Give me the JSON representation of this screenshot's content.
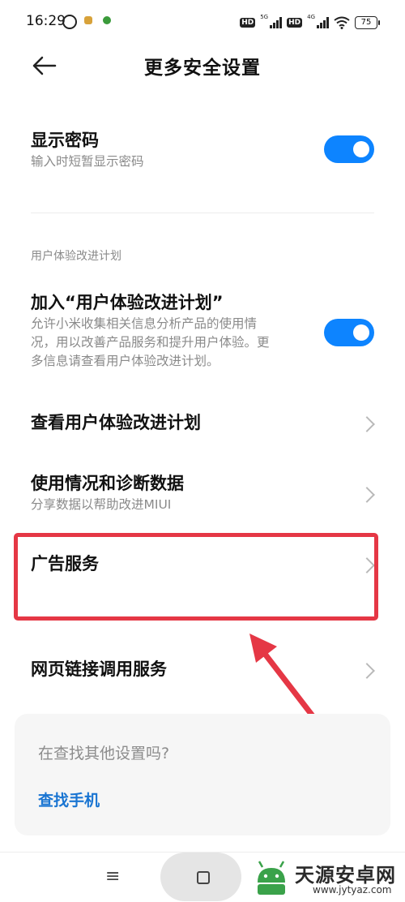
{
  "status_bar": {
    "time": "16:29",
    "hd_label": "HD",
    "net1": "5G",
    "net2": "4G",
    "battery": "75"
  },
  "header": {
    "title": "更多安全设置",
    "back_icon": "back-arrow-icon"
  },
  "settings": {
    "show_password": {
      "title": "显示密码",
      "subtitle": "输入时短暂显示密码",
      "enabled": true
    },
    "section_label": "用户体验改进计划",
    "join_plan": {
      "title": "加入“用户体验改进计划”",
      "subtitle_line1": "允许小米收集相关信息分析产品的使用情",
      "subtitle_line2": "况，用以改善产品服务和提升用户体验。更",
      "subtitle_line3": "多信息请查看用户体验改进计划。",
      "enabled": true
    },
    "view_plan": {
      "title": "查看用户体验改进计划"
    },
    "usage_data": {
      "title": "使用情况和诊断数据",
      "subtitle": "分享数据以帮助改进MIUI"
    },
    "ad_service": {
      "title": "广告服务"
    },
    "web_link": {
      "title": "网页链接调用服务"
    }
  },
  "search_card": {
    "question": "在查找其他设置吗?",
    "link": "查找手机"
  },
  "nav": {
    "menu_icon": "≡"
  },
  "watermark": {
    "name": "天源安卓网",
    "url": "www.jytyaz.com"
  },
  "colors": {
    "accent": "#0d84ff",
    "link": "#1a75d2",
    "annotation": "#e53745"
  }
}
